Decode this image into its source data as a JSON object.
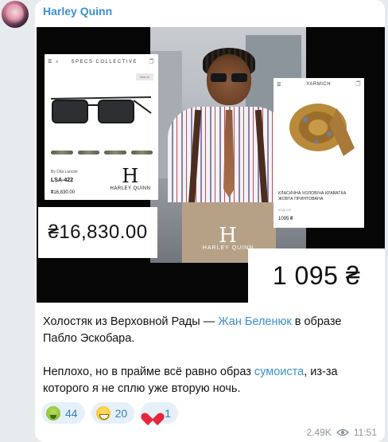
{
  "message": {
    "author": "Harley Quinn",
    "text_part1": "Холостяк из Верховной Рады — ",
    "link_name": "Жан Беленюк",
    "text_part2": " в образе Пабло Эскобара.",
    "text2_part1": "Неплохо, но в прайме всё равно образ ",
    "link_sumo": "сумоиста",
    "text2_part2": ", из-за которого я не сплю уже вторую ночь.",
    "views": "2.49K",
    "time": "11:51"
  },
  "photo": {
    "left_card": {
      "store": "SPECS COLLECTIVE",
      "tag": "New in",
      "brand": "By Dita Lancier",
      "model": "LSA-422",
      "price_small": "₴16,830.00",
      "logo_text": "HARLEY QUINN",
      "logo_mark": "H"
    },
    "left_price": "₴16,830.00",
    "center_logo_text": "HARLEY QUINN",
    "center_logo_mark": "H",
    "right_card": {
      "store": "YARMICH",
      "desc": "КЛАСИЧНА ЧОЛОВІЧА КРАВАТКА ЖОВТА ПРИНТОВАНА",
      "sub": "КОД/100",
      "price_small": "1095 ₴"
    },
    "right_price": "1 095 ₴"
  },
  "reactions": [
    {
      "emoji": "nauseated-face",
      "count": "44"
    },
    {
      "emoji": "grinning-face",
      "count": "20"
    },
    {
      "emoji": "red-heart",
      "count": "1"
    }
  ],
  "colors": {
    "link": "#3a8fd1",
    "background": "#e6ebee",
    "reaction_bg": "#e6f0f8"
  }
}
